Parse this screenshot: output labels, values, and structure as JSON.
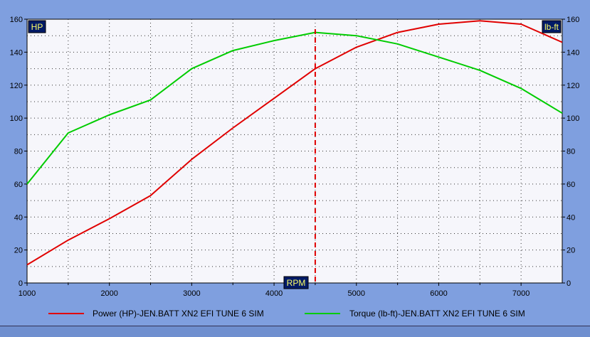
{
  "chart_data": {
    "type": "line",
    "x": [
      1000,
      1500,
      2000,
      2500,
      3000,
      3500,
      4000,
      4500,
      5000,
      5500,
      6000,
      6500,
      7000,
      7500
    ],
    "series": [
      {
        "name": "Power (HP)-JEN.BATT XN2 EFI TUNE 6 SIM",
        "axis": "left",
        "color": "#e00000",
        "values": [
          11,
          26,
          39,
          53,
          75,
          94,
          112,
          130,
          143,
          152,
          157,
          159,
          157,
          146
        ]
      },
      {
        "name": "Torque (lb-ft)-JEN.BATT XN2 EFI TUNE 6 SIM",
        "axis": "right",
        "color": "#00cc00",
        "values": [
          60,
          91,
          102,
          111,
          130,
          141,
          147,
          152,
          150,
          145,
          137,
          129,
          118,
          103
        ]
      }
    ],
    "xlabel": "RPM",
    "ylabel_left": "HP",
    "ylabel_right": "lb-ft",
    "xlim": [
      1000,
      7500
    ],
    "ylim": [
      0,
      160
    ],
    "ylim_right": [
      0,
      160
    ],
    "xticks": [
      1000,
      2000,
      3000,
      4000,
      5000,
      6000,
      7000
    ],
    "yticks": [
      0,
      20,
      40,
      60,
      80,
      100,
      120,
      140,
      160
    ],
    "marker_x": 4500,
    "marker_color": "#e00000",
    "grid": true,
    "legend_position": "bottom",
    "plot_background": "#f6f6fb"
  }
}
